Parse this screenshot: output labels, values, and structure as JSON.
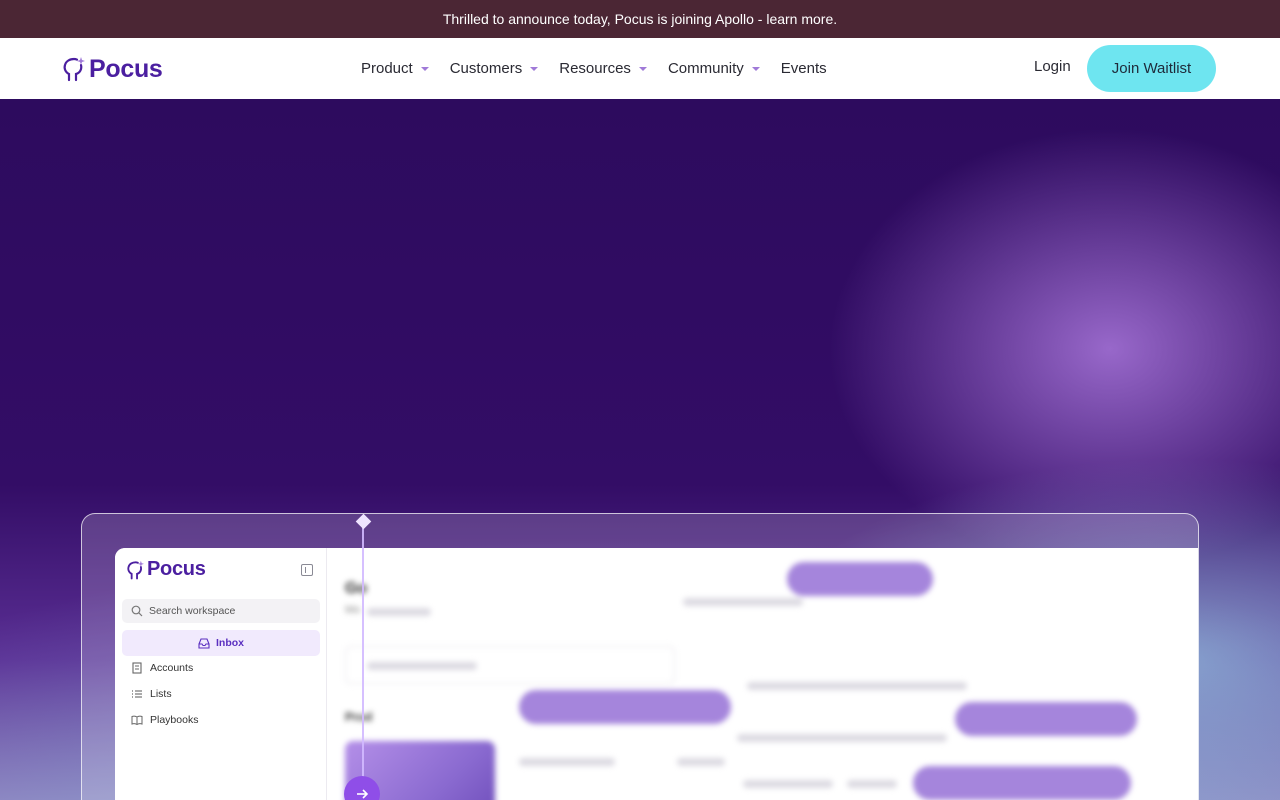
{
  "announcement": {
    "text": "Thrilled to announce today, Pocus is joining Apollo - learn more."
  },
  "brand": {
    "name": "Pocus",
    "color": "#4b1fa0"
  },
  "nav": {
    "items": [
      {
        "label": "Product",
        "has_dropdown": true
      },
      {
        "label": "Customers",
        "has_dropdown": true
      },
      {
        "label": "Resources",
        "has_dropdown": true
      },
      {
        "label": "Community",
        "has_dropdown": true
      },
      {
        "label": "Events",
        "has_dropdown": false
      }
    ],
    "login_label": "Login",
    "cta_label": "Join Waitlist",
    "cta_color": "#6ee5f0"
  },
  "app_preview": {
    "brand": "Pocus",
    "search_placeholder": "Search workspace",
    "sidebar": {
      "items": [
        {
          "label": "Inbox",
          "icon": "inbox-icon",
          "active": true
        },
        {
          "label": "Accounts",
          "icon": "building-icon"
        },
        {
          "label": "Lists",
          "icon": "list-icon"
        },
        {
          "label": "Playbooks",
          "icon": "book-icon"
        }
      ]
    },
    "main": {
      "title_fragment": "Go",
      "subtitle_fragment": "Mo",
      "section_fragment": "Prod"
    }
  },
  "colors": {
    "announcement_bg": "#4b2634",
    "hero_bg": "#2d0b5e",
    "accent_purple": "#8f4ee8"
  }
}
